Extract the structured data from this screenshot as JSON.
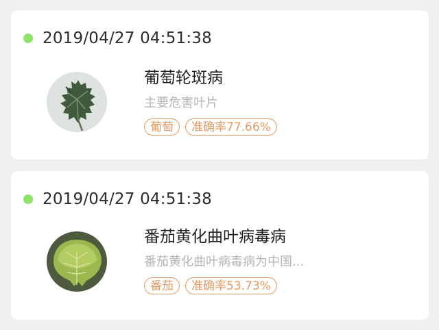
{
  "records": [
    {
      "timestamp": "2019/04/27 04:51:38",
      "disease_name": "葡萄轮斑病",
      "description": "主要危害叶片",
      "crop_tag": "葡萄",
      "accuracy_tag": "准确率77.66%",
      "accuracy": 77.66,
      "thumbnail": "grape-leaf-image"
    },
    {
      "timestamp": "2019/04/27 04:51:38",
      "disease_name": "番茄黄化曲叶病毒病",
      "description": "番茄黄化曲叶病毒病为中国...",
      "crop_tag": "番茄",
      "accuracy_tag": "准确率53.73%",
      "accuracy": 53.73,
      "thumbnail": "tomato-leaf-image"
    }
  ],
  "colors": {
    "status_dot": "#8fe36b",
    "tag_accent": "#e49a63",
    "background": "#eef0f2"
  }
}
